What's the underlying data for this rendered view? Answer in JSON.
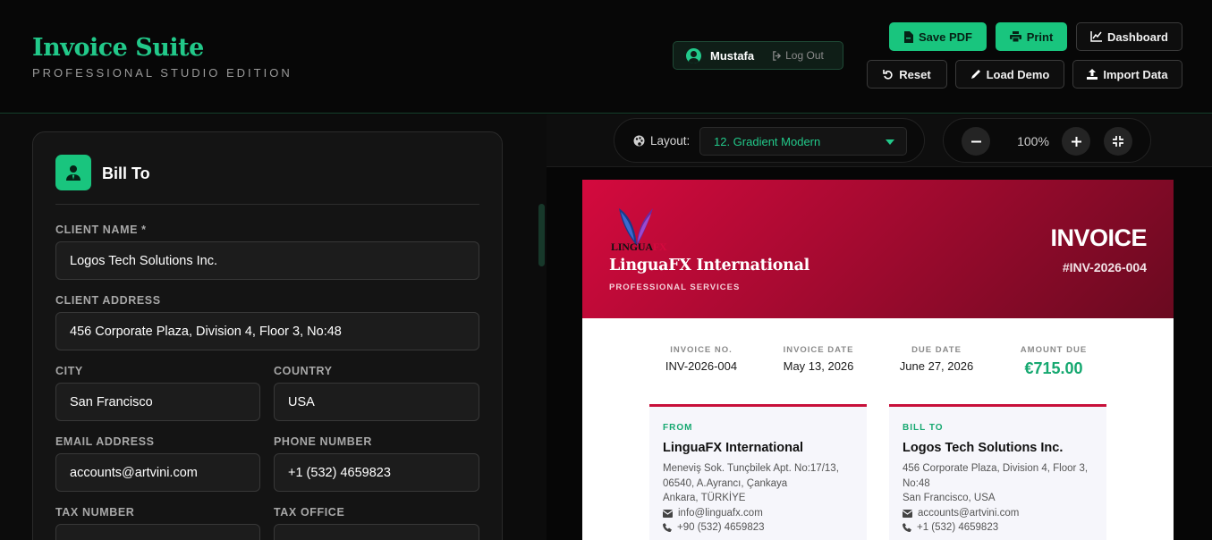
{
  "brand": {
    "title": "Invoice Suite",
    "subtitle": "PROFESSIONAL STUDIO EDITION"
  },
  "user": {
    "name": "Mustafa",
    "logout_label": "Log Out"
  },
  "toolbar": {
    "save_pdf": "Save PDF",
    "print": "Print",
    "dashboard": "Dashboard",
    "reset": "Reset",
    "load_demo": "Load Demo",
    "import_data": "Import Data"
  },
  "bill_to": {
    "title": "Bill To",
    "fields": {
      "client_name": {
        "label": "CLIENT NAME *",
        "value": "Logos Tech Solutions Inc."
      },
      "client_address": {
        "label": "CLIENT ADDRESS",
        "value": "456 Corporate Plaza, Division 4, Floor 3, No:48"
      },
      "city": {
        "label": "CITY",
        "value": "San Francisco"
      },
      "country": {
        "label": "COUNTRY",
        "value": "USA"
      },
      "email": {
        "label": "EMAIL ADDRESS",
        "value": "accounts@artvini.com"
      },
      "phone": {
        "label": "PHONE NUMBER",
        "value": "+1 (532) 4659823"
      },
      "tax_number": {
        "label": "TAX NUMBER",
        "value": ""
      },
      "tax_office": {
        "label": "TAX OFFICE",
        "value": ""
      }
    }
  },
  "preview": {
    "layout_label": "Layout:",
    "layout_value": "12. Gradient Modern",
    "zoom": "100%"
  },
  "invoice": {
    "logo_text_main": "LINGUA",
    "logo_text_accent": "FX",
    "company": "LinguaFX International",
    "tagline": "PROFESSIONAL SERVICES",
    "title": "INVOICE",
    "number": "#INV-2026-004",
    "meta": [
      {
        "label": "INVOICE NO.",
        "value": "INV-2026-004"
      },
      {
        "label": "INVOICE DATE",
        "value": "May 13, 2026"
      },
      {
        "label": "DUE DATE",
        "value": "June 27, 2026"
      },
      {
        "label": "AMOUNT DUE",
        "value": "€715.00"
      }
    ],
    "from": {
      "heading": "FROM",
      "name": "LinguaFX International",
      "lines": [
        "Meneviş Sok. Tunçbilek Apt. No:17/13,",
        "06540, A.Ayrancı, Çankaya",
        "Ankara, TÜRKİYE"
      ],
      "email": "info@linguafx.com",
      "phone": "+90 (532) 4659823"
    },
    "bill_to": {
      "heading": "BILL TO",
      "name": "Logos Tech Solutions Inc.",
      "lines": [
        "456 Corporate Plaza, Division 4, Floor 3,",
        "No:48",
        "San Francisco, USA"
      ],
      "email": "accounts@artvini.com",
      "phone": "+1 (532) 4659823"
    }
  },
  "colors": {
    "accent": "#19c57e",
    "invoice_red": "#c8103a",
    "amount_green": "#16a870"
  }
}
